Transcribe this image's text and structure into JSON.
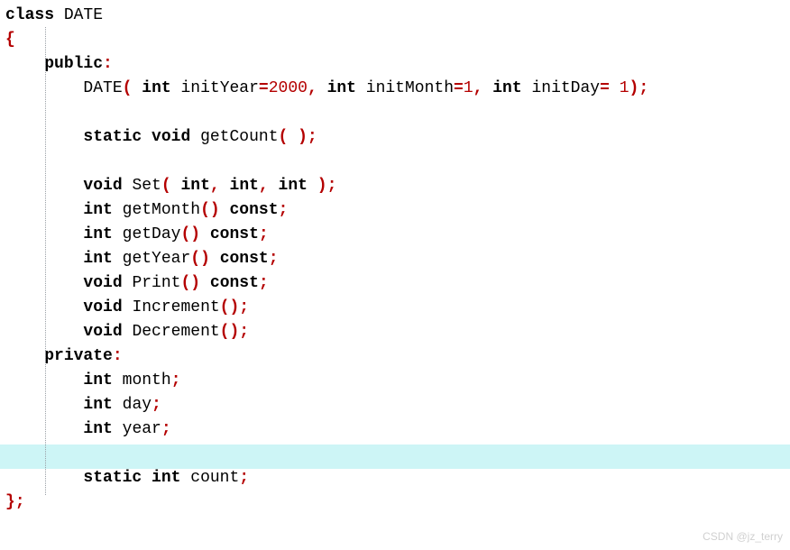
{
  "code": {
    "l01_class": "class",
    "l01_name": "DATE",
    "l02_brace": "{",
    "l03_public": "public",
    "l03_colon": ":",
    "l04_name": "DATE",
    "l04_p1_t": "int",
    "l04_p1_n": "initYear",
    "l04_p1_eq": "=",
    "l04_p1_v": "2000",
    "l04_c1": ",",
    "l04_p2_t": "int",
    "l04_p2_n": "initMonth",
    "l04_p2_eq": "=",
    "l04_p2_v": "1",
    "l04_c2": ",",
    "l04_p3_t": "int",
    "l04_p3_n": "initDay",
    "l04_p3_eq": "=",
    "l04_p3_v": "1",
    "l04_close": ");",
    "l06_static": "static",
    "l06_void": "void",
    "l06_name": "getCount",
    "l06_pa": "( );",
    "l08_void": "void",
    "l08_name": "Set",
    "l08_open": "(",
    "l08_t1": "int",
    "l08_c1": ",",
    "l08_t2": "int",
    "l08_c2": ",",
    "l08_t3": "int",
    "l08_close": ");",
    "l09_int": "int",
    "l09_name": "getMonth",
    "l09_pa": "()",
    "l09_const": "const",
    "l09_sc": ";",
    "l10_int": "int",
    "l10_name": "getDay",
    "l10_pa": "()",
    "l10_const": "const",
    "l10_sc": ";",
    "l11_int": "int",
    "l11_name": "getYear",
    "l11_pa": "()",
    "l11_const": "const",
    "l11_sc": ";",
    "l12_void": "void",
    "l12_name": "Print",
    "l12_pa": "()",
    "l12_const": "const",
    "l12_sc": ";",
    "l13_void": "void",
    "l13_name": "Increment",
    "l13_pa": "();",
    "l14_void": "void",
    "l14_name": "Decrement",
    "l14_pa": "();",
    "l15_private": "private",
    "l15_colon": ":",
    "l16_int": "int",
    "l16_name": "month",
    "l16_sc": ";",
    "l17_int": "int",
    "l17_name": "day",
    "l17_sc": ";",
    "l18_int": "int",
    "l18_name": "year",
    "l18_sc": ";",
    "l20_static": "static",
    "l20_int": "int",
    "l20_name": "count",
    "l20_sc": ";",
    "l21_close": "};"
  },
  "watermark": "CSDN @jz_terry",
  "highlight_top_px": "493"
}
